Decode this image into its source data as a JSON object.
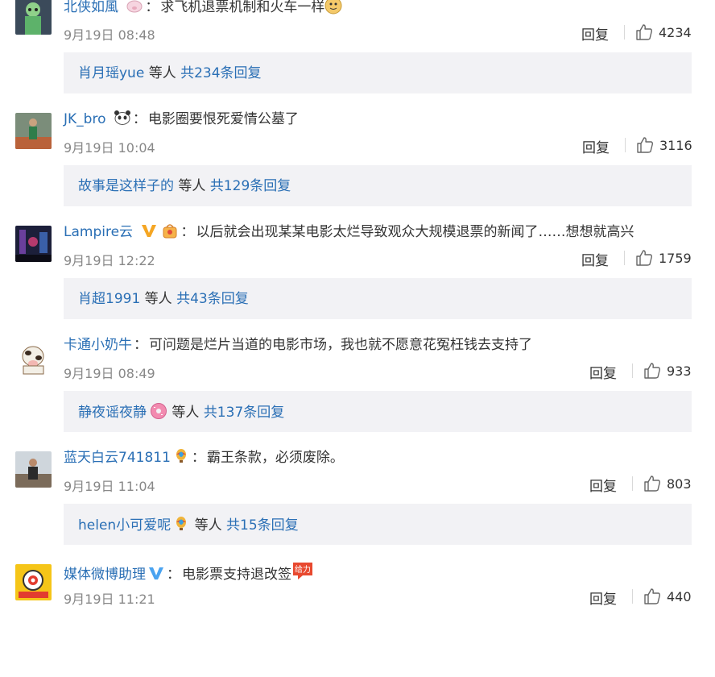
{
  "comments": [
    {
      "username": "北侠如風",
      "text": "求飞机退票机制和火车一样",
      "time": "9月19日 08:48",
      "reply_label": "回复",
      "likes": "4234",
      "reply_users": "肖月瑶yue",
      "reply_mid": " 等人 ",
      "reply_count": "共234条回复"
    },
    {
      "username": "JK_bro",
      "text": "电影圈要恨死爱情公墓了",
      "time": "9月19日 10:04",
      "reply_label": "回复",
      "likes": "3116",
      "reply_users": "故事是这样子的",
      "reply_mid": " 等人 ",
      "reply_count": "共129条回复"
    },
    {
      "username": "Lampire云",
      "text": "以后就会出现某某电影太烂导致观众大规模退票的新闻了……想想就高兴",
      "time": "9月19日 12:22",
      "reply_label": "回复",
      "likes": "1759",
      "reply_users": "肖超1991",
      "reply_mid": " 等人 ",
      "reply_count": "共43条回复"
    },
    {
      "username": "卡通小奶牛",
      "text": "可问题是烂片当道的电影市场，我也就不愿意花冤枉钱去支持了",
      "time": "9月19日 08:49",
      "reply_label": "回复",
      "likes": "933",
      "reply_users": "静夜谣夜静",
      "reply_mid": " 等人 ",
      "reply_count": "共137条回复"
    },
    {
      "username": "蓝天白云741811",
      "text": "霸王条款，必须废除。",
      "time": "9月19日 11:04",
      "reply_label": "回复",
      "likes": "803",
      "reply_users": "helen小可爱呢",
      "reply_mid": " 等人 ",
      "reply_count": "共15条回复"
    },
    {
      "username": "媒体微博助理",
      "text": "电影票支持退改签",
      "time": "9月19日 11:21",
      "reply_label": "回复",
      "likes": "440"
    }
  ],
  "colors": {
    "link": "#2a6fb5",
    "text": "#333333",
    "meta": "#888888",
    "reply_box_bg": "#f2f2f5"
  },
  "icons": {
    "like": "thumb-up-icon",
    "vip_gold": "verified-v-gold-icon",
    "vip_blue": "verified-v-blue-icon"
  },
  "inline_stickers": {
    "c6_sticker_text": "给力"
  }
}
